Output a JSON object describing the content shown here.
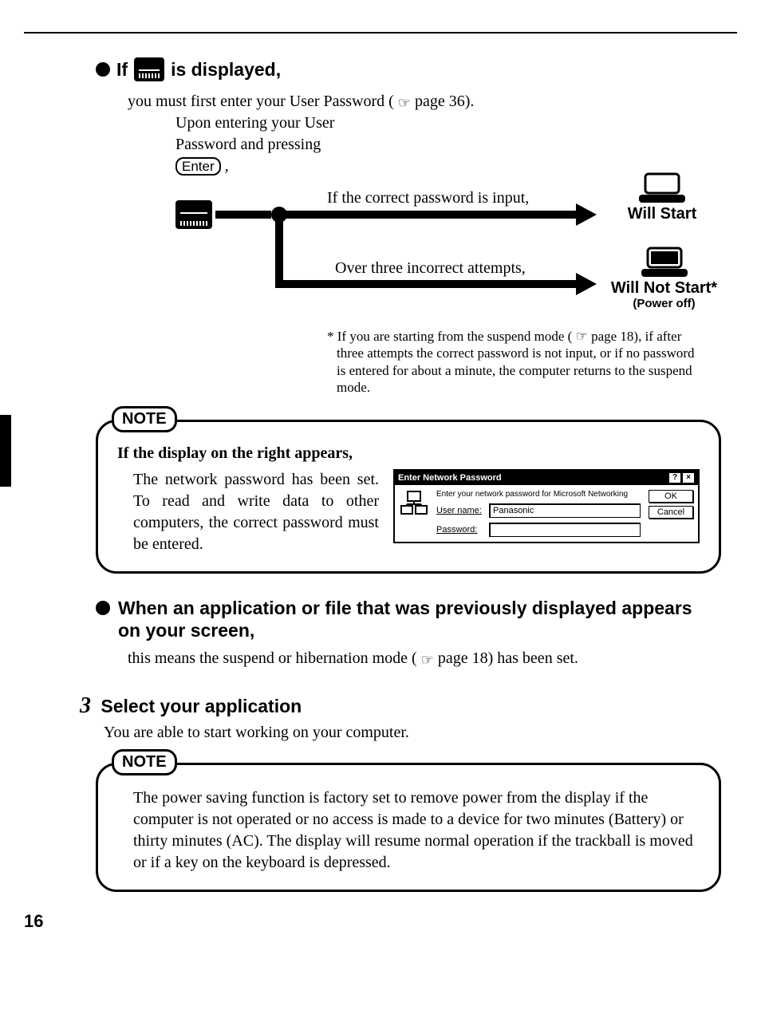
{
  "section1": {
    "if_prefix": "If",
    "if_suffix": "is displayed,",
    "intro_a": "you must first enter your User Password (",
    "intro_page": "page 36).",
    "upon": "Upon entering your User Password and pressing",
    "enter_key": "Enter",
    "upon_comma": ",",
    "correct_label": "If the correct password is input,",
    "incorrect_label": "Over three incorrect attempts,",
    "will_start": "Will Start",
    "will_not_start": "Will Not Start*",
    "power_off": "(Power off)",
    "footnote": "* If you are starting from the suspend mode ( ☞ page 18), if after three attempts the correct password is not input, or if no password is entered for about a minute, the computer returns to the suspend mode."
  },
  "note1": {
    "label": "NOTE",
    "heading": "If the display on the right appears,",
    "text": "The network password has been set.  To read and write data to other computers, the correct password must be entered.",
    "dialog": {
      "title": "Enter Network Password",
      "msg": "Enter your network password for Microsoft Networking",
      "user_label": "User name:",
      "user_value": "Panasonic",
      "pass_label": "Password:",
      "pass_value": "",
      "ok": "OK",
      "cancel": "Cancel"
    }
  },
  "section2": {
    "heading": "When an application or file that was previously displayed appears on your screen,",
    "body_a": "this means the suspend or hibernation mode (",
    "body_page": "page 18) has been set."
  },
  "step3": {
    "num": "3",
    "heading": "Select your application",
    "body": "You are able to start working on your computer."
  },
  "note2": {
    "label": "NOTE",
    "text": "The power saving function is factory set to remove power from the display if the computer is not operated or no access is made to a device for two minutes (Battery) or thirty minutes (AC). The display will resume normal operation if the trackball is moved or if a key on the keyboard is depressed."
  },
  "page_number": "16"
}
